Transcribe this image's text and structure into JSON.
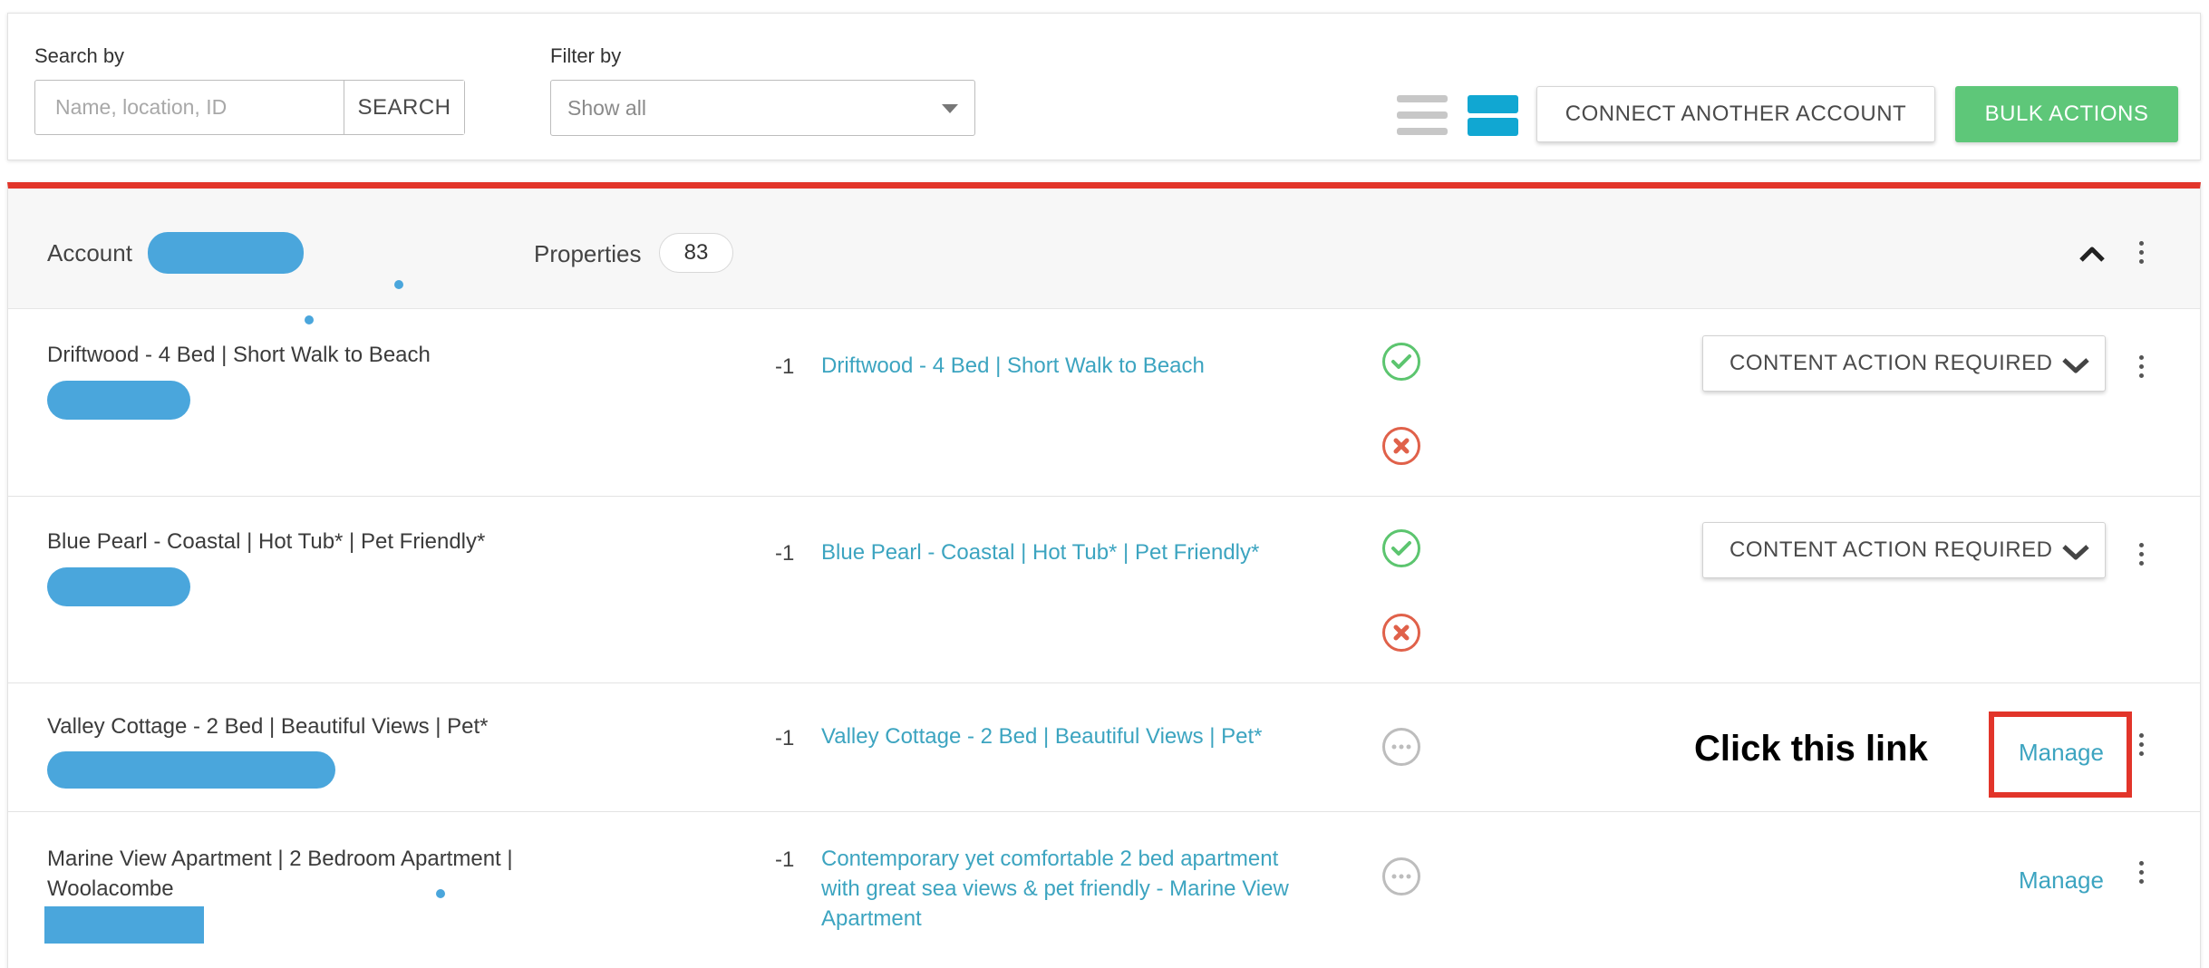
{
  "filters": {
    "search_label": "Search by",
    "search_placeholder": "Name, location, ID",
    "search_button": "SEARCH",
    "filter_label": "Filter by",
    "filter_value": "Show all"
  },
  "toolbar": {
    "list_view_icon": "list-view-icon",
    "card_view_icon": "card-view-icon",
    "connect_button": "CONNECT ANOTHER ACCOUNT",
    "bulk_button": "BULK ACTIONS"
  },
  "account": {
    "label": "Account",
    "properties_label": "Properties",
    "properties_count": "83"
  },
  "rows": [
    {
      "title": "Driftwood - 4 Bed | Short Walk to Beach",
      "num": "-1",
      "link": "Driftwood - 4 Bed | Short Walk to Beach",
      "statuses": [
        "ok",
        "error"
      ],
      "action": "CONTENT ACTION REQUIRED"
    },
    {
      "title": "Blue Pearl - Coastal | Hot Tub* | Pet Friendly*",
      "num": "-1",
      "link": "Blue Pearl - Coastal | Hot Tub* | Pet Friendly*",
      "statuses": [
        "ok",
        "error"
      ],
      "action": "CONTENT ACTION REQUIRED"
    },
    {
      "title": "Valley Cottage - 2 Bed | Beautiful Views | Pet*",
      "num": "-1",
      "link": "Valley Cottage - 2 Bed | Beautiful Views | Pet*",
      "statuses": [
        "pending"
      ],
      "action": "Manage"
    },
    {
      "title_line1": "Marine View Apartment | 2 Bedroom Apartment |",
      "title_line2": "Woolacombe",
      "num": "-1",
      "link_line1": "Contemporary yet comfortable 2 bed apartment",
      "link_line2": "with great sea views & pet friendly - Marine View",
      "link_line3": "Apartment",
      "statuses": [
        "pending"
      ],
      "action": "Manage"
    }
  ],
  "annotation": {
    "text": "Click this link",
    "highlight_color": "#e2352a"
  },
  "colors": {
    "accent": "#3ca4c0",
    "success": "#5cc56f",
    "error": "#e0614a",
    "bulk": "#5ec779",
    "redaction": "#4aa6dc"
  }
}
